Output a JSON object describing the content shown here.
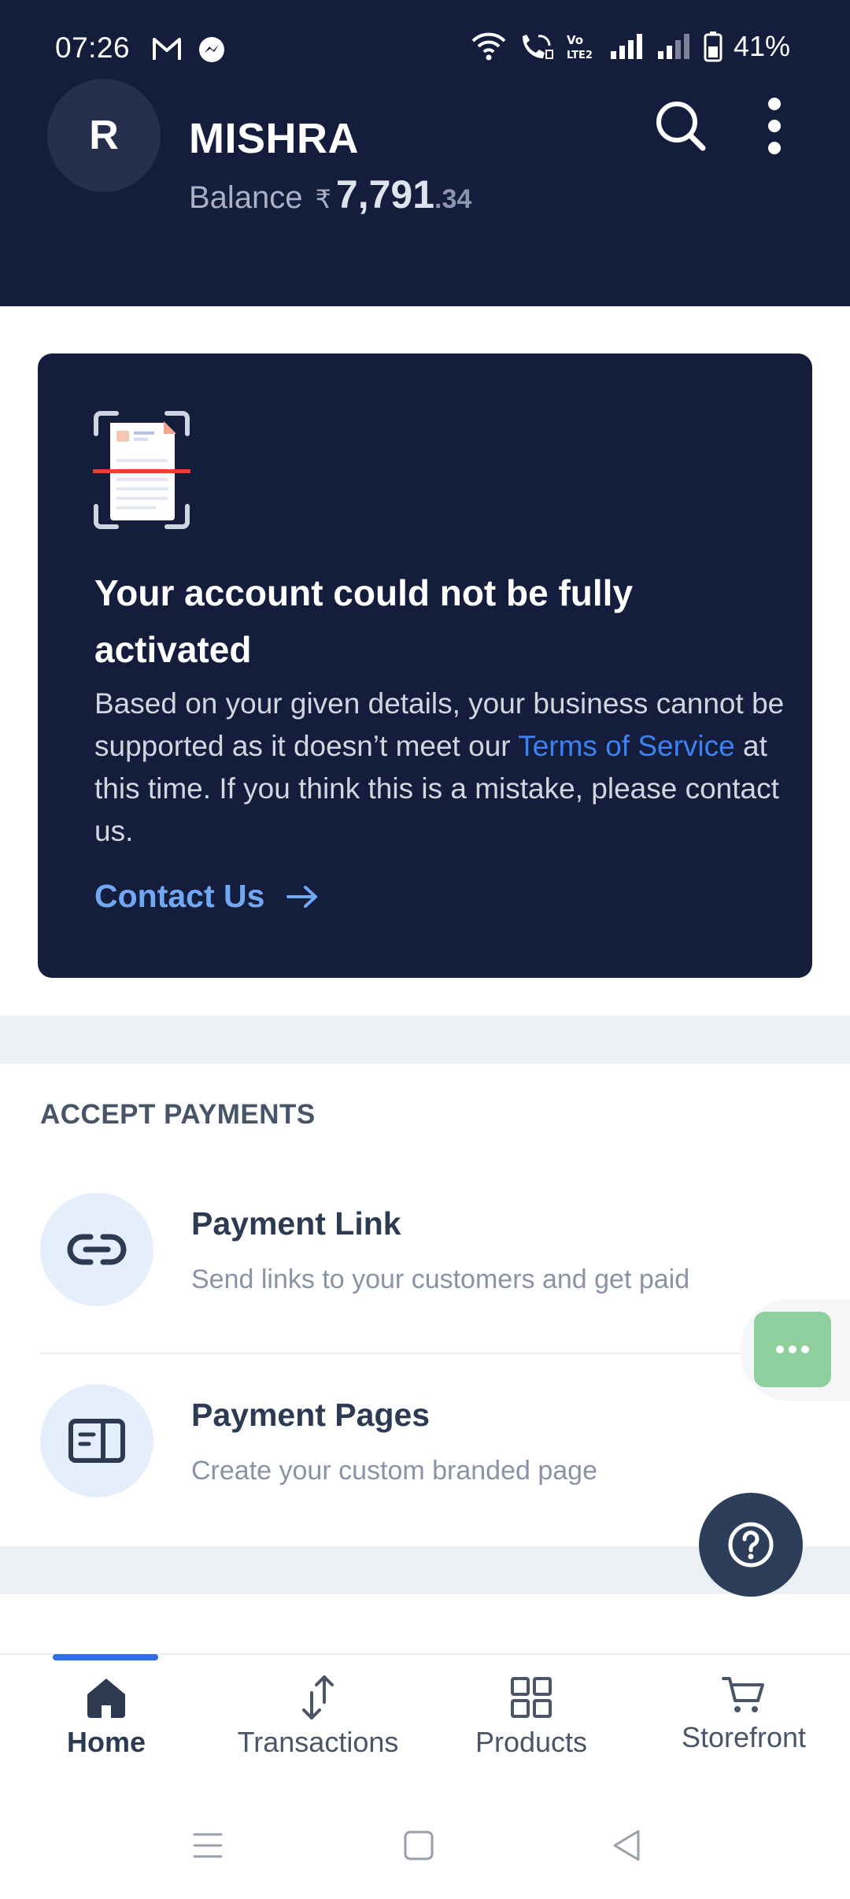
{
  "status_bar": {
    "time": "07:26",
    "battery_percent": "41%",
    "left_icons": [
      "gmail-icon",
      "messenger-icon"
    ],
    "right_icons": [
      "wifi-icon",
      "wifi-calling-icon",
      "volte-icon",
      "signal-icon",
      "signal-icon",
      "battery-icon"
    ]
  },
  "header": {
    "avatar_letter": "R",
    "merchant_name": "MISHRA",
    "balance_label": "Balance",
    "currency_symbol": "₹",
    "balance_whole": "7,791",
    "balance_fraction": ".34",
    "actions": [
      "search-icon",
      "more-vertical-icon"
    ]
  },
  "alert": {
    "title": "Your account could not be fully activated",
    "body_before_link": "Based on your given details, your business cannot be supported as it doesn’t meet our ",
    "link_text": "Terms of Service",
    "body_after_link": " at this time. If you think this is a mistake, please contact us.",
    "cta_label": "Contact Us",
    "accent_color": "#3b82f6"
  },
  "accept_payments": {
    "section_title": "ACCEPT PAYMENTS",
    "items": [
      {
        "title": "Payment Link",
        "description": "Send links to your customers and get paid",
        "icon": "link-icon"
      },
      {
        "title": "Payment Pages",
        "description": "Create your custom branded page",
        "icon": "page-layout-icon"
      }
    ]
  },
  "bottom_nav": {
    "items": [
      {
        "label": "Home",
        "icon": "home-icon",
        "active": true
      },
      {
        "label": "Transactions",
        "icon": "transfer-arrows-icon",
        "active": false
      },
      {
        "label": "Products",
        "icon": "grid-icon",
        "active": false
      },
      {
        "label": "Storefront",
        "icon": "cart-icon",
        "active": false
      }
    ],
    "active_color": "#2f6fe4"
  },
  "colors": {
    "header_bg": "#141d3b",
    "chat_fab": "#8fcf9d",
    "help_fab": "#2d3e5b"
  }
}
